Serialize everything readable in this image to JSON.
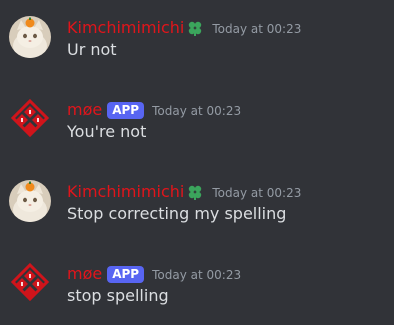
{
  "colors": {
    "background": "#313338",
    "username": "#e0151b",
    "app_tag": "#5865f2",
    "role_icon": "#3ba55c",
    "timestamp": "#949ba4",
    "message_text": "#dbdee1"
  },
  "messages": [
    {
      "author": "Kimchimimichi",
      "avatar_icon": "cat-avatar",
      "role_icon": "leaf-role-icon",
      "timestamp": "Today at 00:23",
      "content": "Ur not"
    },
    {
      "author": "møe",
      "avatar_icon": "red-emblem-avatar",
      "tag": "APP",
      "timestamp": "Today at 00:23",
      "content": "You're not"
    },
    {
      "author": "Kimchimimichi",
      "avatar_icon": "cat-avatar",
      "role_icon": "leaf-role-icon",
      "timestamp": "Today at 00:23",
      "content": "Stop correcting my spelling"
    },
    {
      "author": "møe",
      "avatar_icon": "red-emblem-avatar",
      "tag": "APP",
      "timestamp": "Today at 00:23",
      "content": "stop spelling"
    }
  ]
}
